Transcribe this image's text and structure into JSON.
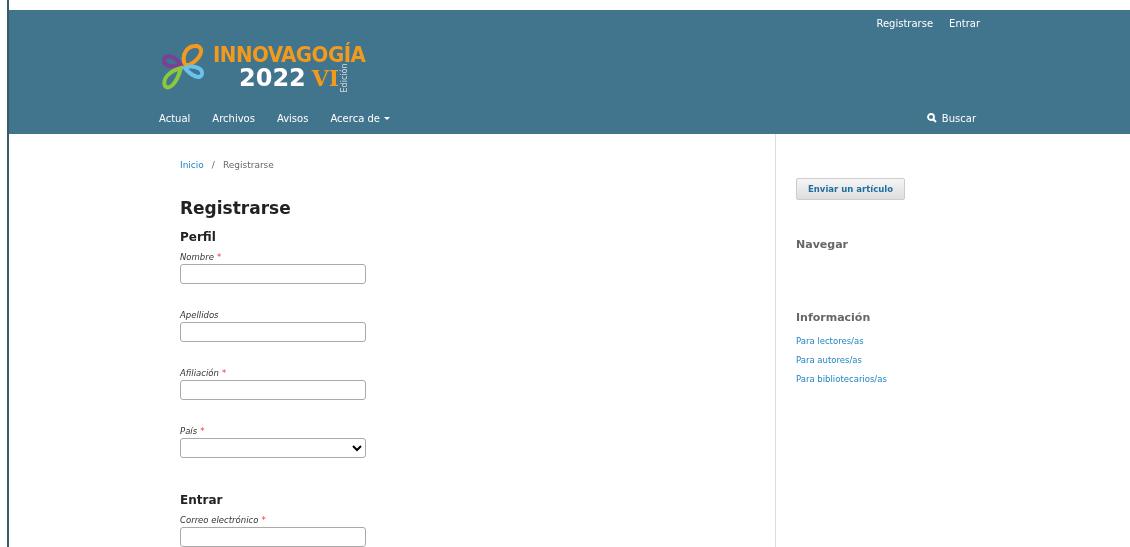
{
  "user_nav": [
    "Registrarse",
    "Entrar"
  ],
  "logo": {
    "name": "INNOVAGOGÍA",
    "year": "2022",
    "edition": "VI",
    "edition_label": "Edición"
  },
  "main_nav": [
    {
      "label": "Actual",
      "dropdown": false
    },
    {
      "label": "Archivos",
      "dropdown": false
    },
    {
      "label": "Avisos",
      "dropdown": false
    },
    {
      "label": "Acerca de",
      "dropdown": true
    }
  ],
  "search": "Buscar",
  "breadcrumb": {
    "home": "Inicio",
    "separator": "/",
    "current": "Registrarse"
  },
  "title": "Registrarse",
  "sections": [
    {
      "heading": "Perfil",
      "fields": [
        {
          "label": "Nombre",
          "required_mark": "*",
          "kind": "text"
        },
        {
          "label": "Apellidos",
          "kind": "text"
        },
        {
          "label": "Afiliación",
          "required_mark": "*",
          "kind": "text"
        },
        {
          "label": "País",
          "required_mark": "*",
          "kind": "select"
        }
      ]
    },
    {
      "heading": "Entrar",
      "fields": [
        {
          "label": "Correo electrónico",
          "required_mark": "*",
          "kind": "text"
        }
      ]
    }
  ],
  "sidebar": {
    "button": "Enviar un artículo",
    "blocks": [
      {
        "heading": "Navegar"
      },
      {
        "heading": "Información",
        "links": [
          "Para lectores/as",
          "Para autores/as",
          "Para bibliotecarios/as"
        ]
      }
    ]
  }
}
